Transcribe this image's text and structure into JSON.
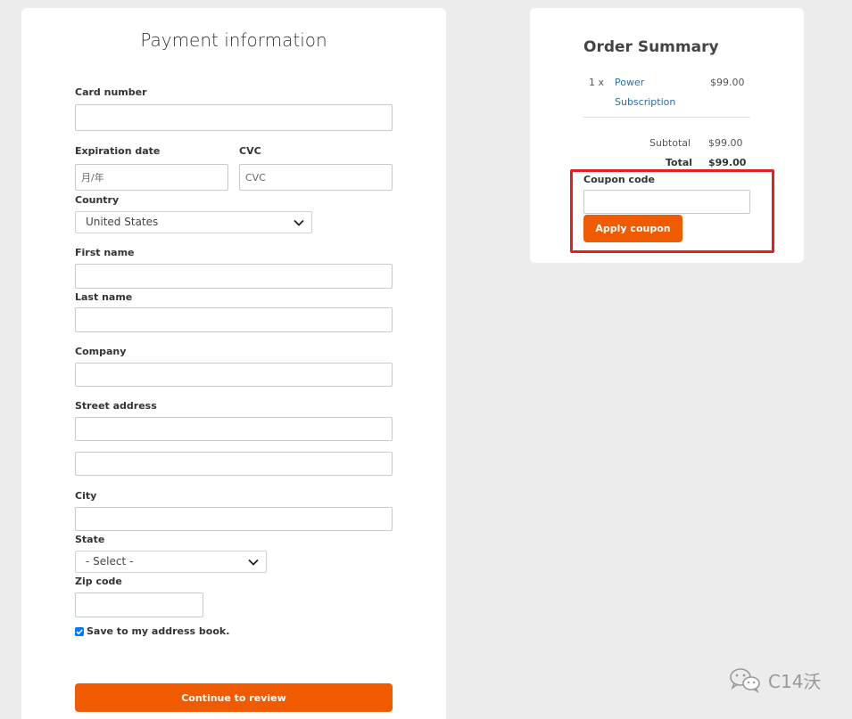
{
  "payment": {
    "title": "Payment information",
    "card_number_label": "Card number",
    "expiration_label": "Expiration date",
    "expiration_placeholder": "月/年",
    "cvc_label": "CVC",
    "cvc_placeholder": "CVC",
    "country_label": "Country",
    "country_value": "United States",
    "first_name_label": "First name",
    "last_name_label": "Last name",
    "company_label": "Company",
    "street_label": "Street address",
    "city_label": "City",
    "state_label": "State",
    "state_value": "- Select -",
    "zip_label": "Zip code",
    "save_address_label": "Save to my address book.",
    "save_address_checked": true,
    "continue_label": "Continue to review"
  },
  "summary": {
    "title": "Order Summary",
    "item_qty": "1 x",
    "item_name_line1": "Power",
    "item_name_line2": "Subscription",
    "item_price": "$99.00",
    "subtotal_label": "Subtotal",
    "subtotal_value": "$99.00",
    "total_label": "Total",
    "total_value": "$99.00",
    "coupon_label": "Coupon code",
    "coupon_button": "Apply coupon"
  },
  "colors": {
    "accent": "#f05a00",
    "link": "#2a6fad",
    "highlight": "#e61e1e"
  },
  "watermark": {
    "text": "C14沃",
    "icon": "wechat-icon"
  }
}
